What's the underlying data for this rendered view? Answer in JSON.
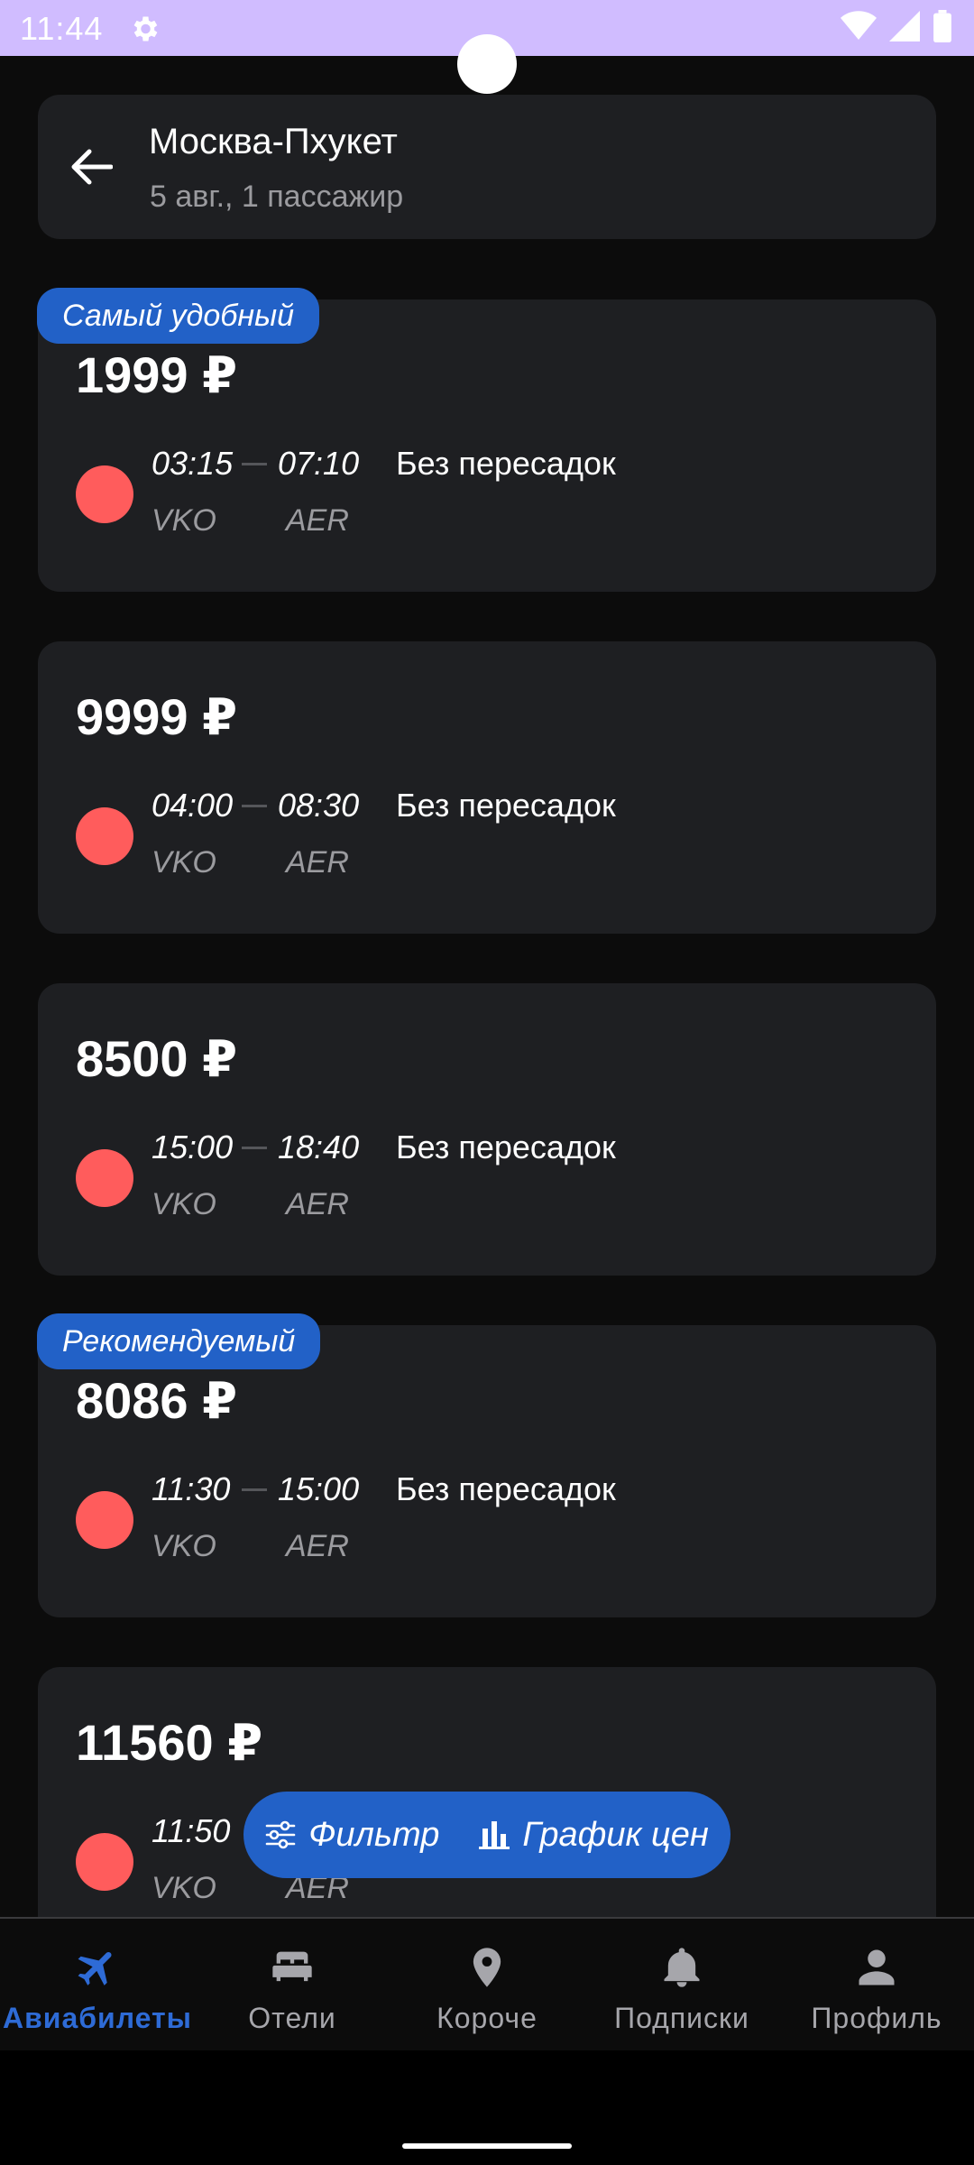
{
  "status_bar": {
    "time": "11:44",
    "icons": [
      "settings-icon",
      "wifi-icon",
      "signal-icon",
      "battery-icon"
    ],
    "background": "#d0bcff"
  },
  "header": {
    "back_icon": "arrow-left-icon",
    "title": "Москва-Пхукет",
    "subtitle": "5 авг., 1 пассажир"
  },
  "tickets": [
    {
      "badge": "Самый удобный",
      "price": "1999 ₽",
      "departure_time": "03:15",
      "arrival_time": "07:10",
      "transfers": "Без пересадок",
      "departure_code": "VKO",
      "arrival_code": "AER"
    },
    {
      "badge": "",
      "price": "9999 ₽",
      "departure_time": "04:00",
      "arrival_time": "08:30",
      "transfers": "Без пересадок",
      "departure_code": "VKO",
      "arrival_code": "AER"
    },
    {
      "badge": "",
      "price": "8500 ₽",
      "departure_time": "15:00",
      "arrival_time": "18:40",
      "transfers": "Без пересадок",
      "departure_code": "VKO",
      "arrival_code": "AER"
    },
    {
      "badge": "Рекомендуемый",
      "price": "8086 ₽",
      "departure_time": "11:30",
      "arrival_time": "15:00",
      "transfers": "Без пересадок",
      "departure_code": "VKO",
      "arrival_code": "AER"
    },
    {
      "badge": "",
      "price": "11560 ₽",
      "departure_time": "11:50",
      "departure_code": "VKO",
      "arrival_code": "AER"
    }
  ],
  "fab": {
    "filter_label": "Фильтр",
    "filter_icon": "sliders-icon",
    "chart_label": "График цен",
    "chart_icon": "bar-chart-icon"
  },
  "bottom_nav": {
    "items": [
      {
        "label": "Авиабилеты",
        "icon": "airplane-icon",
        "active": true
      },
      {
        "label": "Отели",
        "icon": "bed-icon",
        "active": false
      },
      {
        "label": "Короче",
        "icon": "location-pin-icon",
        "active": false
      },
      {
        "label": "Подписки",
        "icon": "bell-icon",
        "active": false
      },
      {
        "label": "Профиль",
        "icon": "person-icon",
        "active": false
      }
    ]
  },
  "colors": {
    "background": "#0c0c0c",
    "card": "#1e1f22",
    "accent": "#2261c7",
    "active_nav": "#2e6bd6",
    "airline_logo": "#ff5c5c",
    "muted_text": "#9b9b9f"
  }
}
